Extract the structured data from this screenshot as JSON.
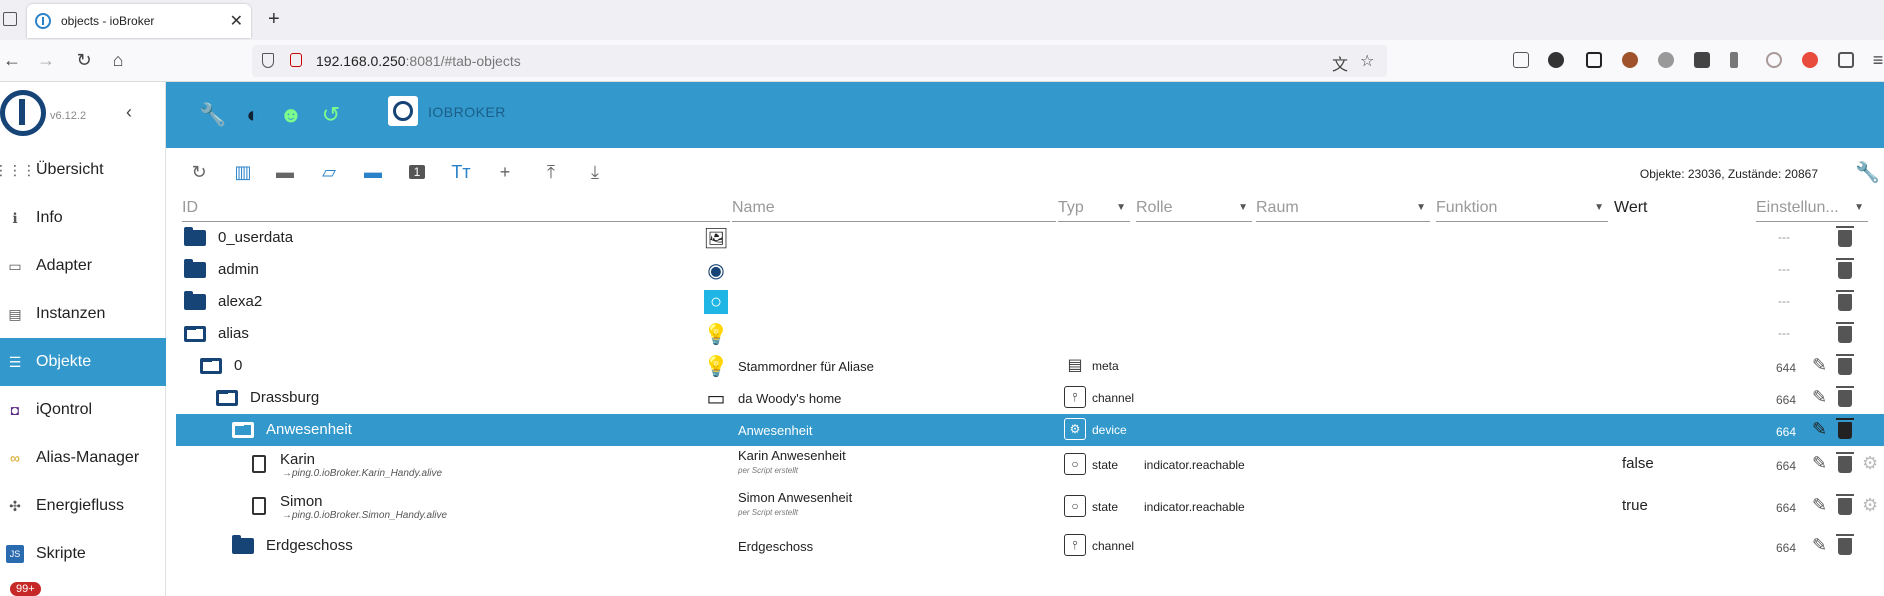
{
  "browser": {
    "tab_title": "objects - ioBroker",
    "tab_close": "✕",
    "new_tab": "+",
    "url_host": "192.168.0.250",
    "url_rest": ":8081/#tab-objects"
  },
  "sidebar": {
    "version": "v6.12.2",
    "collapse": "‹",
    "items": [
      {
        "label": "Übersicht",
        "icon": "⋮⋮⋮"
      },
      {
        "label": "Info",
        "icon": "ℹ"
      },
      {
        "label": "Adapter",
        "icon": "▭"
      },
      {
        "label": "Instanzen",
        "icon": "▤"
      },
      {
        "label": "Objekte",
        "icon": "☰"
      },
      {
        "label": "iQontrol",
        "icon": "◘"
      },
      {
        "label": "Alias-Manager",
        "icon": "∞"
      },
      {
        "label": "Energiefluss",
        "icon": "✣"
      },
      {
        "label": "Skripte",
        "icon": "JS"
      }
    ],
    "badge": "99+"
  },
  "topbar": {
    "brand": "IOBROKER"
  },
  "toolbar": {
    "counts": "Objekte: 23036, Zustände: 20867",
    "instance_id_icon": "1",
    "text_size_icon": "Tт"
  },
  "columns": {
    "id": "ID",
    "name": "Name",
    "type": "Typ",
    "role": "Rolle",
    "room": "Raum",
    "function": "Funktion",
    "value": "Wert",
    "settings": "Einstellun..."
  },
  "rows": [
    {
      "id": "0_userdata",
      "name": "",
      "type": "",
      "role": "",
      "value": "",
      "perm": "---"
    },
    {
      "id": "admin",
      "name": "",
      "type": "",
      "role": "",
      "value": "",
      "perm": "---"
    },
    {
      "id": "alexa2",
      "name": "",
      "type": "",
      "role": "",
      "value": "",
      "perm": "---"
    },
    {
      "id": "alias",
      "name": "",
      "type": "",
      "role": "",
      "value": "",
      "perm": "---"
    },
    {
      "id": "0",
      "name": "Stammordner für Aliase",
      "type": "meta",
      "role": "",
      "value": "",
      "perm": "644"
    },
    {
      "id": "Drassburg",
      "name": "da Woody's home",
      "type": "channel",
      "role": "",
      "value": "",
      "perm": "664"
    },
    {
      "id": "Anwesenheit",
      "name": "Anwesenheit",
      "type": "device",
      "role": "",
      "value": "",
      "perm": "664"
    },
    {
      "id": "Karin",
      "subid": "→ping.0.ioBroker.Karin_Handy.alive",
      "name": "Karin Anwesenheit",
      "namesub": "per Script erstellt",
      "type": "state",
      "role": "indicator.reachable",
      "value": "false",
      "perm": "664"
    },
    {
      "id": "Simon",
      "subid": "→ping.0.ioBroker.Simon_Handy.alive",
      "name": "Simon Anwesenheit",
      "namesub": "per Script erstellt",
      "type": "state",
      "role": "indicator.reachable",
      "value": "true",
      "perm": "664"
    },
    {
      "id": "Erdgeschoss",
      "name": "Erdgeschoss",
      "type": "channel",
      "role": "",
      "value": "",
      "perm": "664"
    }
  ]
}
